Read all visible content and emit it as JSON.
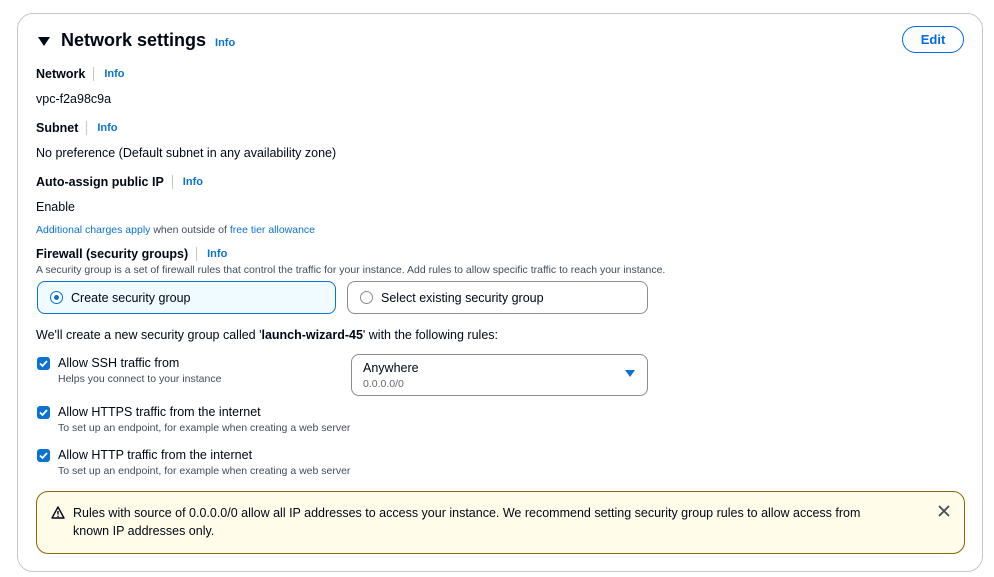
{
  "section": {
    "title": "Network settings",
    "info": "Info",
    "edit_label": "Edit"
  },
  "network": {
    "label": "Network",
    "info": "Info",
    "value": "vpc-f2a98c9a"
  },
  "subnet": {
    "label": "Subnet",
    "info": "Info",
    "value": "No preference (Default subnet in any availability zone)"
  },
  "public_ip": {
    "label": "Auto-assign public IP",
    "info": "Info",
    "value": "Enable",
    "charges_link": "Additional charges apply",
    "charges_mid": " when outside of ",
    "free_tier_link": "free tier allowance"
  },
  "firewall": {
    "label": "Firewall (security groups)",
    "info": "Info",
    "description": "A security group is a set of firewall rules that control the traffic for your instance. Add rules to allow specific traffic to reach your instance.",
    "options": [
      {
        "label": "Create security group",
        "selected": true
      },
      {
        "label": "Select existing security group",
        "selected": false
      }
    ],
    "new_group_prefix": "We'll create a new security group called '",
    "new_group_name": "launch-wizard-45",
    "new_group_suffix": "' with the following rules:"
  },
  "rules": [
    {
      "label": "Allow SSH traffic from",
      "help": "Helps you connect to your instance",
      "checked": true
    },
    {
      "label": "Allow HTTPS traffic from the internet",
      "help": "To set up an endpoint, for example when creating a web server",
      "checked": true
    },
    {
      "label": "Allow HTTP traffic from the internet",
      "help": "To set up an endpoint, for example when creating a web server",
      "checked": true
    }
  ],
  "ssh_source": {
    "value": "Anywhere",
    "sub": "0.0.0.0/0"
  },
  "warning": {
    "text": "Rules with source of 0.0.0.0/0 allow all IP addresses to access your instance. We recommend setting security group rules to allow access from known IP addresses only."
  },
  "colors": {
    "link": "#0972d3",
    "primary_border": "#006ce0",
    "warning_bg": "#fffce9",
    "warning_border": "#8d6605"
  }
}
